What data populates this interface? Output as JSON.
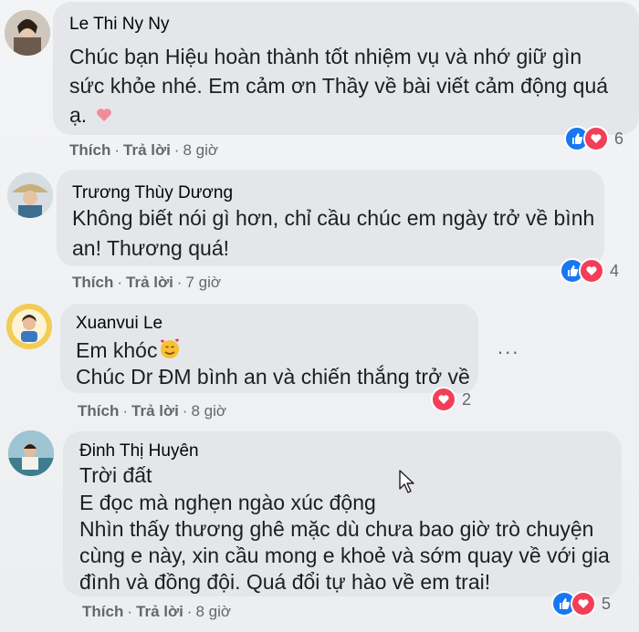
{
  "comments": [
    {
      "author": "Le Thi Ny Ny",
      "lines": [
        "Chúc bạn Hiệu hoàn thành tốt nhiệm vụ và nhớ giữ gìn",
        "sức khỏe nhé. Em cảm ơn Thầy về bài viết cảm động quá",
        "ạ."
      ],
      "emoji": "heart",
      "like": "Thích",
      "reply": "Trả lời",
      "time": "8 giờ",
      "reaction_count": "6",
      "reactions": [
        "like-icon",
        "love-icon"
      ]
    },
    {
      "author": "Trương Thùy Dương",
      "lines": [
        "Không biết nói gì hơn, chỉ cầu chúc em ngày trở về bình",
        "an! Thương quá!"
      ],
      "like": "Thích",
      "reply": "Trả lời",
      "time": "7 giờ",
      "reaction_count": "4",
      "reactions": [
        "like-icon",
        "love-icon"
      ]
    },
    {
      "author": "Xuanvui Le",
      "lines": [
        "Em khóc",
        "Chúc Dr ĐM bình an và chiến thắng trở về"
      ],
      "emoji": "smiling-face-with-hearts",
      "like": "Thích",
      "reply": "Trả lời",
      "time": "8 giờ",
      "reaction_count": "2",
      "reactions": [
        "love-icon"
      ]
    },
    {
      "author": "Đinh Thị Huyên",
      "lines": [
        "Trời đất",
        "E đọc mà nghẹn ngào xúc động",
        "Nhìn thấy thương ghê mặc dù chưa bao giờ trò chuyện",
        "cùng e này, xin cầu mong e khoẻ và sớm quay về với gia",
        "đình và đồng đội. Quá đổi tự hào về em trai!"
      ],
      "like": "Thích",
      "reply": "Trả lời",
      "time": "8 giờ",
      "reaction_count": "5",
      "reactions": [
        "like-icon",
        "love-icon"
      ]
    }
  ],
  "more_options": "...",
  "colors": {
    "like": "#1877f2",
    "love": "#f33e58",
    "bubble": "#e4e6ea",
    "meta": "#65676b"
  }
}
